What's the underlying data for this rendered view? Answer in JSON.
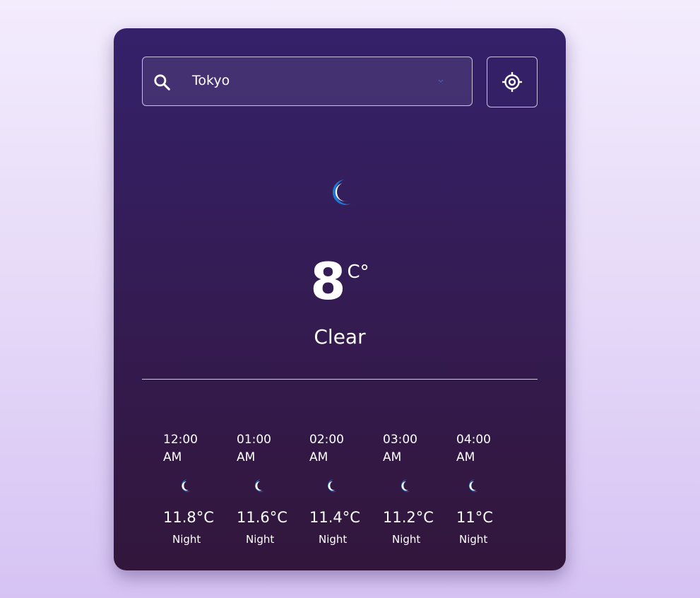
{
  "search": {
    "value": "Tokyo"
  },
  "current": {
    "icon": "moon-icon",
    "temperature": "8",
    "unit": "C°",
    "condition": "Clear"
  },
  "hourly": [
    {
      "time": "12:00 AM",
      "icon": "moon-icon",
      "temp": "11.8°C",
      "period": "Night"
    },
    {
      "time": "01:00 AM",
      "icon": "moon-icon",
      "temp": "11.6°C",
      "period": "Night"
    },
    {
      "time": "02:00 AM",
      "icon": "moon-icon",
      "temp": "11.4°C",
      "period": "Night"
    },
    {
      "time": "03:00 AM",
      "icon": "moon-icon",
      "temp": "11.2°C",
      "period": "Night"
    },
    {
      "time": "04:00 AM",
      "icon": "moon-icon",
      "temp": "11°C",
      "period": "Night"
    }
  ],
  "colors": {
    "moon": "#1e78d2",
    "moon_fill": "#ffffff",
    "card_top": "#34216a",
    "card_bottom": "#32163b",
    "chevron": "#3b5bb0"
  }
}
